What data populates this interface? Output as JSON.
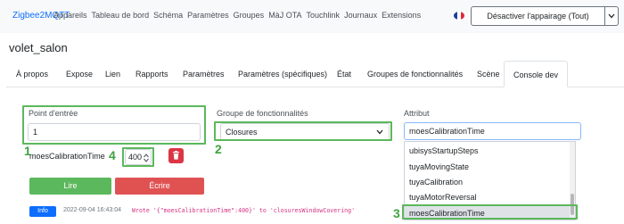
{
  "navbar": {
    "brand": "Zigbee2MQTT",
    "links": [
      "Appareils",
      "Tableau de bord",
      "Schéma",
      "Paramètres",
      "Groupes",
      "MàJ OTA",
      "Touchlink",
      "Journaux",
      "Extensions"
    ],
    "language_flag_icon": "french-flag-icon",
    "permit_join_label": "Désactiver l'appairage (Tout)"
  },
  "device": {
    "title": "volet_salon"
  },
  "tabs": [
    "À propos",
    "Expose",
    "Lien",
    "Rapports",
    "Paramètres",
    "Paramètres (spécifiques)",
    "État",
    "Groupes de fonctionnalités",
    "Scène",
    "Console dev"
  ],
  "active_tab": "Console dev",
  "form": {
    "endpoint_label": "Point d'entrée",
    "endpoint_value": "1",
    "cluster_label": "Groupe de fonctionnalités",
    "cluster_value": "Closures",
    "attribute_label": "Attribut",
    "attribute_value": "moesCalibrationTime",
    "attr_row_label": "moesCalibrationTime",
    "attr_row_value": "400"
  },
  "buttons": {
    "read": "Lire",
    "write": "Écrire"
  },
  "log": {
    "level": "Info",
    "timestamp": "2022-09-04 16:43:04",
    "message": "Wrote '{\"moesCalibrationTime\":400}' to 'closuresWindowCovering'"
  },
  "attribute_options": [
    "ubisysStartupSteps",
    "tuyaMovingState",
    "tuyaCalibration",
    "tuyaMotorReversal",
    "moesCalibrationTime"
  ],
  "annotations": [
    "1",
    "2",
    "3",
    "4"
  ],
  "colors": {
    "highlight": "#5cb85c",
    "read": "#5cb85c",
    "write": "#e05252",
    "delete": "#dc3545",
    "brand": "#0d6efd"
  }
}
